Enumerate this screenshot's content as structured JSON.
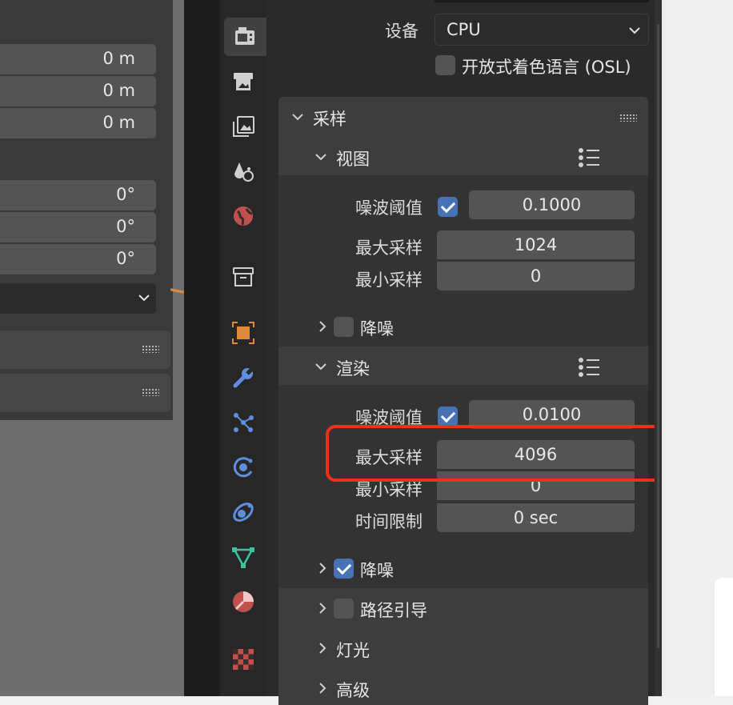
{
  "left_panel": {
    "location_fields": [
      "0 m",
      "0 m",
      "0 m"
    ],
    "rotation_fields": [
      "0°",
      "0°",
      "0°"
    ]
  },
  "icons": {
    "tabs": [
      "render-tab-icon",
      "output-tab-icon",
      "view-layer-tab-icon",
      "scene-tab-icon",
      "world-tab-icon",
      "collection-tab-icon",
      "object-tab-icon",
      "modifier-tab-icon",
      "particles-tab-icon",
      "physics-tab-icon",
      "constraints-tab-icon",
      "data-tab-icon",
      "material-tab-icon",
      "texture-tab-icon"
    ]
  },
  "device": {
    "label": "设备",
    "value": "CPU",
    "osl_label": "开放式着色语言 (OSL)"
  },
  "sampling": {
    "title": "采样",
    "viewport": {
      "title": "视图",
      "noise_threshold_label": "噪波阈值",
      "noise_threshold_value": "0.1000",
      "max_samples_label": "最大采样",
      "max_samples_value": "1024",
      "min_samples_label": "最小采样",
      "min_samples_value": "0",
      "denoise_label": "降噪"
    },
    "render": {
      "title": "渲染",
      "noise_threshold_label": "噪波阈值",
      "noise_threshold_value": "0.0100",
      "max_samples_label": "最大采样",
      "max_samples_value": "4096",
      "min_samples_label": "最小采样",
      "min_samples_value": "0",
      "time_limit_label": "时间限制",
      "time_limit_value": "0 sec",
      "denoise_label": "降噪"
    },
    "path_guiding_label": "路径引导",
    "lights_label": "灯光",
    "advanced_label": "高级"
  },
  "colors": {
    "highlight": "#e8321e",
    "checkbox_on": "#4772b3",
    "accent_orange": "#e08a3c"
  }
}
